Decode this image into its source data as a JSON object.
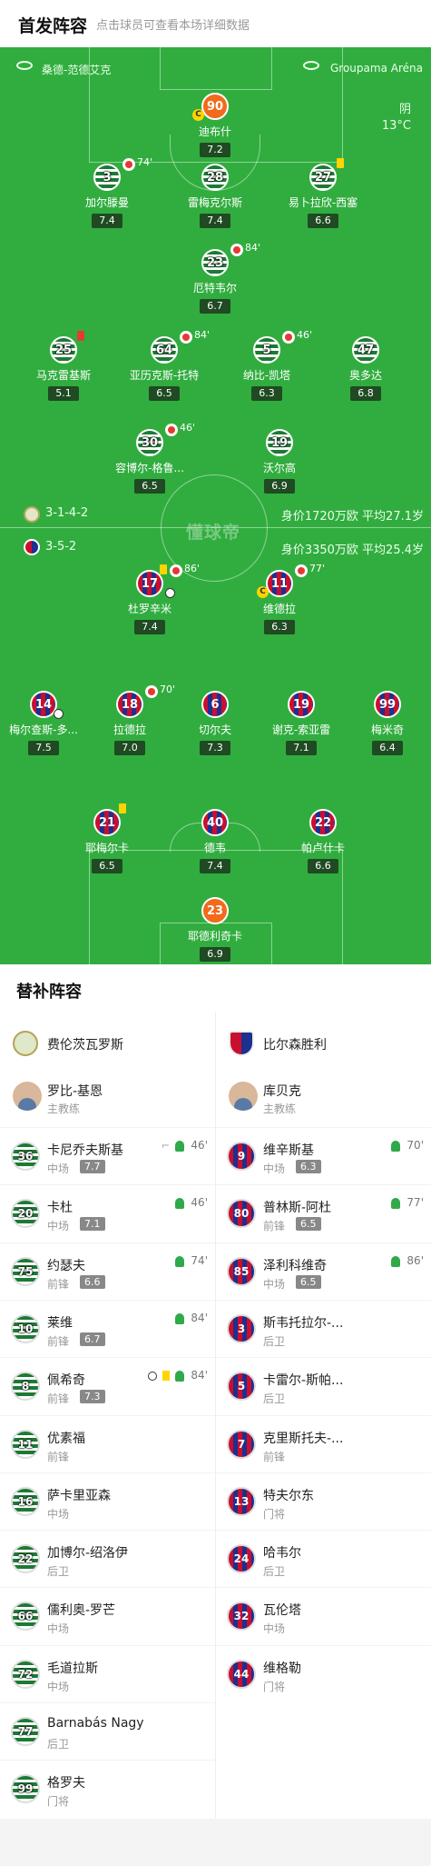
{
  "header": {
    "title": "首发阵容",
    "subtitle": "点击球员可查看本场详细数据"
  },
  "pitch": {
    "home_venue": "桑德-范德艾克",
    "away_venue": "Groupama Aréna",
    "weather": {
      "condition": "阴",
      "temperature": "13°C"
    },
    "watermark": "懂球帝",
    "home_formation": "3-1-4-2",
    "home_value": "身价1720万欧 平均27.1岁",
    "away_formation": "3-5-2",
    "away_value": "身价3350万欧 平均25.4岁"
  },
  "home_players": [
    {
      "number": "90",
      "name": "迪布什",
      "rating": "7.2"
    },
    {
      "number": "3",
      "name": "加尔滕曼",
      "rating": "7.4",
      "sub_time": "74'"
    },
    {
      "number": "28",
      "name": "雷梅克尔斯",
      "rating": "7.4"
    },
    {
      "number": "27",
      "name": "易卜拉欣-西塞",
      "rating": "6.6"
    },
    {
      "number": "23",
      "name": "厄特韦尔",
      "rating": "6.7",
      "sub_time": "84'"
    },
    {
      "number": "25",
      "name": "马克雷基斯",
      "rating": "5.1"
    },
    {
      "number": "64",
      "name": "亚历克斯-托特",
      "rating": "6.5",
      "sub_time": "84'"
    },
    {
      "number": "5",
      "name": "纳比-凯塔",
      "rating": "6.3",
      "sub_time": "46'"
    },
    {
      "number": "47",
      "name": "奥多达",
      "rating": "6.8"
    },
    {
      "number": "30",
      "name": "容博尔-格鲁...",
      "rating": "6.5",
      "sub_time": "46'"
    },
    {
      "number": "19",
      "name": "沃尔高",
      "rating": "6.9"
    }
  ],
  "away_players": [
    {
      "number": "17",
      "name": "杜罗辛米",
      "rating": "7.4",
      "sub_time": "86'"
    },
    {
      "number": "11",
      "name": "维德拉",
      "rating": "6.3",
      "sub_time": "77'"
    },
    {
      "number": "14",
      "name": "梅尔查斯-多...",
      "rating": "7.5"
    },
    {
      "number": "18",
      "name": "拉德拉",
      "rating": "7.0",
      "sub_time": "70'"
    },
    {
      "number": "6",
      "name": "切尔夫",
      "rating": "7.3"
    },
    {
      "number": "19",
      "name": "谢克-索亚雷",
      "rating": "7.1"
    },
    {
      "number": "99",
      "name": "梅米奇",
      "rating": "6.4"
    },
    {
      "number": "21",
      "name": "耶梅尔卡",
      "rating": "6.5"
    },
    {
      "number": "40",
      "name": "德韦",
      "rating": "7.4"
    },
    {
      "number": "22",
      "name": "帕卢什卡",
      "rating": "6.6"
    },
    {
      "number": "23",
      "name": "耶德利奇卡",
      "rating": "6.9"
    }
  ],
  "subs": {
    "title": "替补阵容",
    "home_team": "费伦茨瓦罗斯",
    "away_team": "比尔森胜利",
    "home_coach": {
      "name": "罗比-基恩",
      "role": "主教练"
    },
    "away_coach": {
      "name": "库贝克",
      "role": "主教练"
    },
    "home": [
      {
        "number": "36",
        "name": "卡尼乔夫斯基",
        "pos": "中场",
        "rating": "7.7",
        "in": "46'"
      },
      {
        "number": "20",
        "name": "卡杜",
        "pos": "中场",
        "rating": "7.1",
        "in": "46'"
      },
      {
        "number": "75",
        "name": "约瑟夫",
        "pos": "前锋",
        "rating": "6.6",
        "in": "74'"
      },
      {
        "number": "10",
        "name": "莱维",
        "pos": "前锋",
        "rating": "6.7",
        "in": "84'"
      },
      {
        "number": "8",
        "name": "佩希奇",
        "pos": "前锋",
        "rating": "7.3",
        "in": "84'"
      },
      {
        "number": "11",
        "name": "优素福",
        "pos": "前锋"
      },
      {
        "number": "16",
        "name": "萨卡里亚森",
        "pos": "中场"
      },
      {
        "number": "22",
        "name": "加博尔-绍洛伊",
        "pos": "后卫"
      },
      {
        "number": "66",
        "name": "儒利奥-罗芒",
        "pos": "中场"
      },
      {
        "number": "72",
        "name": "毛道拉斯",
        "pos": "中场"
      },
      {
        "number": "77",
        "name": "Barnabás Nagy",
        "pos": "后卫"
      },
      {
        "number": "99",
        "name": "格罗夫",
        "pos": "门将"
      }
    ],
    "away": [
      {
        "number": "9",
        "name": "维辛斯基",
        "pos": "中场",
        "rating": "6.3",
        "in": "70'"
      },
      {
        "number": "80",
        "name": "普林斯-阿杜",
        "pos": "前锋",
        "rating": "6.5",
        "in": "77'"
      },
      {
        "number": "85",
        "name": "泽利科维奇",
        "pos": "中场",
        "rating": "6.5",
        "in": "86'"
      },
      {
        "number": "3",
        "name": "斯韦托拉尔-...",
        "pos": "后卫"
      },
      {
        "number": "5",
        "name": "卡雷尔-斯帕...",
        "pos": "后卫"
      },
      {
        "number": "7",
        "name": "克里斯托夫-...",
        "pos": "前锋"
      },
      {
        "number": "13",
        "name": "特夫尔东",
        "pos": "门将"
      },
      {
        "number": "24",
        "name": "哈韦尔",
        "pos": "后卫"
      },
      {
        "number": "32",
        "name": "瓦伦塔",
        "pos": "中场"
      },
      {
        "number": "44",
        "name": "维格勒",
        "pos": "门将"
      }
    ]
  }
}
